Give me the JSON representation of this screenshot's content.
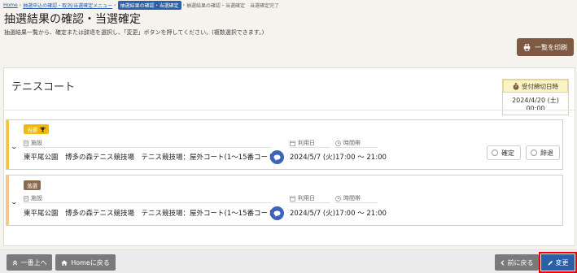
{
  "breadcrumb": {
    "items": [
      "Home",
      "抽選申込の確認・取消/当選確定メニュー",
      "抽選結果の確認・当選確定",
      "抽選結果の確認・当選確定　当選確定完了"
    ]
  },
  "page": {
    "title": "抽選結果の確認・当選確定",
    "description": "抽選結果一覧から、確定または辞退を選択し、「変更」ボタンを押してください。(複数選択できます。)"
  },
  "toolbar": {
    "print_label": "一覧を印刷"
  },
  "facility_card": {
    "title": "テニスコート",
    "deadline_label": "受付締切日時",
    "deadline_value": "2024/4/20 (土) 00:00"
  },
  "results": [
    {
      "status": "当選",
      "status_color": "#f5b800",
      "stripe_color": "#f5c242",
      "facility_label": "施設",
      "facility": "東平尾公園　博多の森テニス競技場　テニス競技場：屋外コート(1〜15番コート)",
      "date_label": "利用日",
      "date": "2024/5/7 (火)",
      "time_label": "時間帯",
      "time": "17:00 ～ 21:00",
      "options": [
        "確定",
        "辞退"
      ]
    },
    {
      "status": "落選",
      "status_color": "#8a6a4a",
      "stripe_color": "#f5c785",
      "facility_label": "施設",
      "facility": "東平尾公園　博多の森テニス競技場　テニス競技場：屋外コート(1〜15番コート)",
      "date_label": "利用日",
      "date": "2024/5/7 (火)",
      "time_label": "時間帯",
      "time": "17:00 ～ 21:00"
    }
  ],
  "footer": {
    "top_label": "一番上へ",
    "home_label": "Homeに戻る",
    "back_label": "前に戻る",
    "change_label": "変更"
  },
  "colors": {
    "accent": "#2b5fa8",
    "print_button": "#7e5a45",
    "highlight": "#e00000"
  }
}
